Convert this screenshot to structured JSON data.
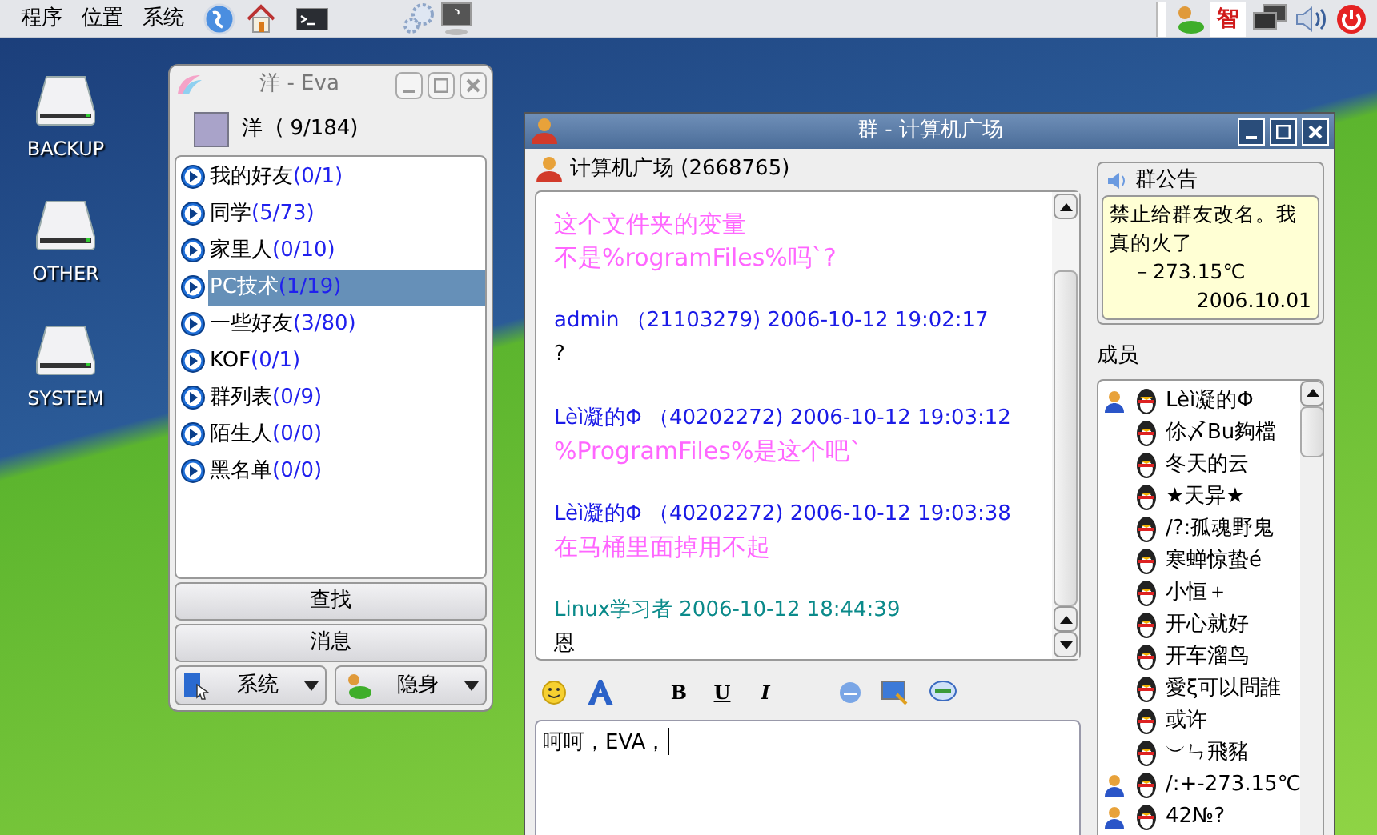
{
  "top_panel": {
    "menus": [
      "程序",
      "位置",
      "系统"
    ],
    "ime": "智"
  },
  "desktop_icons": [
    {
      "label": "BACKUP"
    },
    {
      "label": "OTHER"
    },
    {
      "label": "SYSTEM"
    }
  ],
  "eva_window": {
    "title": "洋 - Eva",
    "user": {
      "name": "洋",
      "count": "( 9/184)"
    },
    "groups": [
      {
        "name": "我的好友",
        "count": "(0/1)",
        "selected": false
      },
      {
        "name": "同学",
        "count": "(5/73)",
        "selected": false
      },
      {
        "name": "家里人",
        "count": "(0/10)",
        "selected": false
      },
      {
        "name": "PC技术",
        "count": "(1/19)",
        "selected": true
      },
      {
        "name": "一些好友",
        "count": "(3/80)",
        "selected": false
      },
      {
        "name": "KOF",
        "count": "(0/1)",
        "selected": false
      },
      {
        "name": "群列表",
        "count": "(0/9)",
        "selected": false
      },
      {
        "name": "陌生人",
        "count": "(0/0)",
        "selected": false
      },
      {
        "name": "黑名单",
        "count": "(0/0)",
        "selected": false
      }
    ],
    "buttons": [
      "查找",
      "消息"
    ],
    "menus": [
      "系统",
      "隐身"
    ]
  },
  "chat_window": {
    "title": "群 - 计算机广场",
    "group_header": "计算机广场 (2668765)",
    "messages": [
      {
        "kind": "body",
        "text": "这个文件夹的变量",
        "color": "#ff66ff"
      },
      {
        "kind": "body",
        "text": "不是%rogramFiles%吗`?",
        "color": "#ff66ff"
      },
      {
        "kind": "header",
        "text": "admin （21103279) 2006-10-12 19:02:17",
        "color": "#1a1ae6"
      },
      {
        "kind": "plain",
        "text": "?",
        "color": "#000000"
      },
      {
        "kind": "header",
        "text": "Lèì凝的Φ （40202272) 2006-10-12 19:03:12",
        "color": "#1a1ae6"
      },
      {
        "kind": "body",
        "text": "%ProgramFiles%是这个吧`",
        "color": "#ff66ff"
      },
      {
        "kind": "header",
        "text": "Lèì凝的Φ （40202272) 2006-10-12 19:03:38",
        "color": "#1a1ae6"
      },
      {
        "kind": "body",
        "text": "在马桶里面掉用不起",
        "color": "#ff66ff"
      },
      {
        "kind": "header",
        "text": "Linux学习者 2006-10-12 18:44:39",
        "color": "#0a8a8a"
      },
      {
        "kind": "plain",
        "text": "恩",
        "color": "#000000"
      }
    ],
    "format_buttons": [
      "B",
      "U",
      "I"
    ],
    "input": {
      "value": "呵呵，EVA，"
    },
    "notice": {
      "title": "群公告",
      "text": "禁止给群友改名。我真的火了",
      "temperature": "－273.15℃",
      "date": "2006.10.01"
    },
    "members_label": "成员",
    "members": [
      {
        "name": "Lèì凝的Φ",
        "online": true
      },
      {
        "name": "伱〆Bu夠檔",
        "online": false
      },
      {
        "name": "冬天的云",
        "online": false
      },
      {
        "name": "★天异★",
        "online": false
      },
      {
        "name": "/?:孤魂野鬼",
        "online": false
      },
      {
        "name": "寒蝉惊蛰é",
        "online": false
      },
      {
        "name": "小恒＋",
        "online": false
      },
      {
        "name": "开心就好",
        "online": false
      },
      {
        "name": "开车溜鸟",
        "online": false
      },
      {
        "name": "愛ξ可以問誰",
        "online": false
      },
      {
        "name": "或许",
        "online": false
      },
      {
        "name": "︶ㄣ飛豬",
        "online": false
      },
      {
        "name": "/:+-273.15℃",
        "online": true
      },
      {
        "name": "42№?",
        "online": true
      }
    ]
  }
}
